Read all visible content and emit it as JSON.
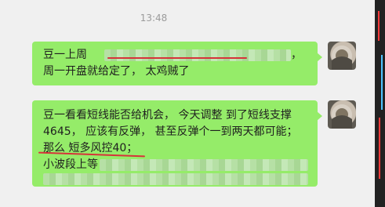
{
  "time": "13:48",
  "messages": [
    {
      "lines": [
        "豆一上周",
        "，",
        "周一开盘就给定了，  太鸡贼了"
      ]
    },
    {
      "lines": [
        "豆一看看短线能否给机会，  今天调整 到了短线支撑",
        "4645，  应该有反弹，  甚至反弹个一到两天都可能；",
        "那么 短多风控40；",
        "小波段上等"
      ]
    }
  ],
  "colors": {
    "bubble": "#95ec69",
    "background": "#f0f0f0",
    "annotation": "#d6333a"
  },
  "icons": {
    "avatar": "user-avatar-icon"
  }
}
